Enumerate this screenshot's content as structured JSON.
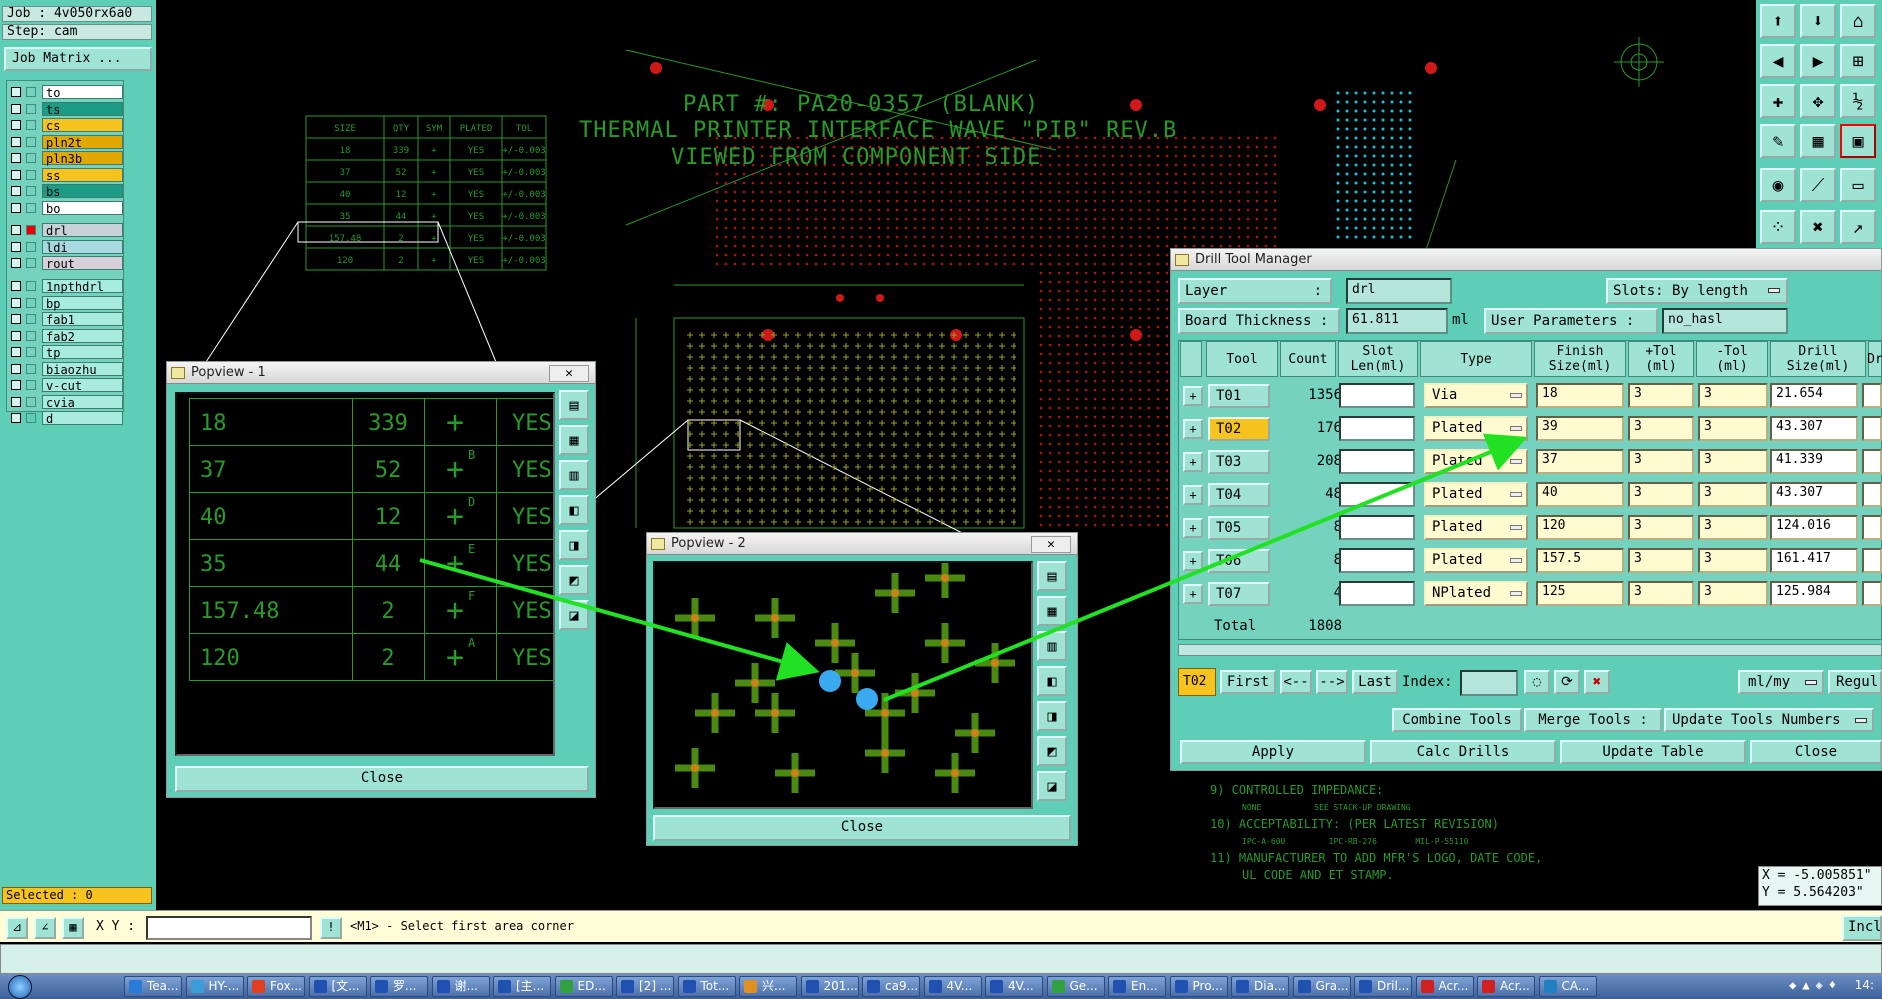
{
  "job_panel": {
    "job": "Job : 4v050rx6a0",
    "step": "Step: cam",
    "job_matrix_label": "Job Matrix ...",
    "layers": [
      {
        "name": "to",
        "color": "#ffffff",
        "pen": true
      },
      {
        "name": "ts",
        "color": "#1c9c84",
        "pen": false
      },
      {
        "name": "cs",
        "color": "#f7c31e",
        "pen": false
      },
      {
        "name": "pln2t",
        "color": "#e0a800",
        "pen": false
      },
      {
        "name": "pln3b",
        "color": "#e0a800",
        "pen": false
      },
      {
        "name": "ss",
        "color": "#f7c31e",
        "pen": false
      },
      {
        "name": "bs",
        "color": "#1c9c84",
        "pen": false
      },
      {
        "name": "bo",
        "color": "#ffffff",
        "pen": true
      },
      {
        "name": "drl",
        "color": "#c8d0d8",
        "pen": false
      },
      {
        "name": "ldi",
        "color": "#a8d8e0",
        "pen": false
      },
      {
        "name": "rout",
        "color": "#d8d0d8",
        "pen": false
      },
      {
        "name": "1npthdrl",
        "color": "#a8ece0",
        "pen": false
      },
      {
        "name": "bp",
        "color": "#a8ece0",
        "pen": false
      },
      {
        "name": "fab1",
        "color": "#a8ece0",
        "pen": true
      },
      {
        "name": "fab2",
        "color": "#a8ece0",
        "pen": true
      },
      {
        "name": "tp",
        "color": "#a8ece0",
        "pen": false
      },
      {
        "name": "biaozhu",
        "color": "#a8ece0",
        "pen": false
      },
      {
        "name": "v-cut",
        "color": "#a8ece0",
        "pen": false
      },
      {
        "name": "cvia",
        "color": "#a8ece0",
        "pen": false
      },
      {
        "name": "d",
        "color": "#a8ece0",
        "pen": false
      }
    ],
    "selected": "Selected : 0"
  },
  "canvas": {
    "title_lines": [
      "PART #: PA20-0357 (BLANK)",
      "THERMAL PRINTER INTERFACE WAVE \"PIB\" REV.B",
      "VIEWED FROM COMPONENT SIDE"
    ],
    "drill_table_headers": [
      "SIZE",
      "QTY",
      "SYM",
      "PLATED",
      "TOL"
    ],
    "drill_table_rows": [
      [
        "18",
        "339",
        "+",
        "YES",
        "+/-0.003"
      ],
      [
        "37",
        "52",
        "+",
        "YES",
        "+/-0.003"
      ],
      [
        "40",
        "12",
        "+",
        "YES",
        "+/-0.003"
      ],
      [
        "35",
        "44",
        "+",
        "YES",
        "+/-0.003"
      ],
      [
        "157.48",
        "2",
        "+",
        "YES",
        "+/-0.003"
      ],
      [
        "120",
        "2",
        "+",
        "YES",
        "+/-0.003"
      ]
    ],
    "notes": [
      "9) CONTROLLED IMPEDANCE:",
      "NONE",
      "SEE STACK-UP DRAWING",
      "10) ACCEPTABILITY: (PER LATEST REVISION)",
      "IPC-A-600",
      "IPC-RB-276",
      "MIL-P-55110",
      "11) MANUFACTURER TO ADD MFR'S LOGO, DATE CODE,",
      "UL CODE AND ET STAMP."
    ],
    "coord_x": "X = -5.005851\"",
    "coord_y": "Y = 5.564203\""
  },
  "popview1": {
    "title": "Popview - 1",
    "close_label": "Close",
    "rows": [
      {
        "size": "18",
        "qty": "339",
        "sym": "",
        "plated": "YES"
      },
      {
        "size": "37",
        "qty": "52",
        "sym": "B",
        "plated": "YES"
      },
      {
        "size": "40",
        "qty": "12",
        "sym": "D",
        "plated": "YES"
      },
      {
        "size": "35",
        "qty": "44",
        "sym": "E",
        "plated": "YES"
      },
      {
        "size": "157.48",
        "qty": "2",
        "sym": "F",
        "plated": "YES"
      },
      {
        "size": "120",
        "qty": "2",
        "sym": "A",
        "plated": "YES"
      }
    ]
  },
  "popview2": {
    "title": "Popview - 2",
    "close_label": "Close"
  },
  "drill_manager": {
    "title": "Drill Tool Manager",
    "layer_label": "Layer",
    "layer_value": "drl",
    "slots_label": "Slots:",
    "slots_value": "By length",
    "thickness_label": "Board Thickness :",
    "thickness_value": "61.811",
    "thickness_unit": "ml",
    "user_params_label": "User Parameters :",
    "user_params_value": "no_hasl",
    "columns": [
      "Tool",
      "Count",
      "Slot Len(ml)",
      "Type",
      "Finish Size(ml)",
      "+Tol (ml)",
      "-Tol (ml)",
      "Drill Size(ml)",
      "Dr"
    ],
    "tools": [
      {
        "tool": "T01",
        "count": "1356",
        "type": "Via",
        "finish": "18",
        "ptol": "3",
        "mtol": "3",
        "drill": "21.654"
      },
      {
        "tool": "T02",
        "count": "176",
        "type": "Plated",
        "finish": "39",
        "ptol": "3",
        "mtol": "3",
        "drill": "43.307"
      },
      {
        "tool": "T03",
        "count": "208",
        "type": "Plated",
        "finish": "37",
        "ptol": "3",
        "mtol": "3",
        "drill": "41.339"
      },
      {
        "tool": "T04",
        "count": "48",
        "type": "Plated",
        "finish": "40",
        "ptol": "3",
        "mtol": "3",
        "drill": "43.307"
      },
      {
        "tool": "T05",
        "count": "8",
        "type": "Plated",
        "finish": "120",
        "ptol": "3",
        "mtol": "3",
        "drill": "124.016"
      },
      {
        "tool": "T06",
        "count": "8",
        "type": "Plated",
        "finish": "157.5",
        "ptol": "3",
        "mtol": "3",
        "drill": "161.417"
      },
      {
        "tool": "T07",
        "count": "4",
        "type": "NPlated",
        "finish": "125",
        "ptol": "3",
        "mtol": "3",
        "drill": "125.984"
      }
    ],
    "total_label": "Total",
    "total_count": "1808",
    "current_tool": "T02",
    "first_label": "First",
    "prev_label": "<--",
    "next_label": "-->",
    "last_label": "Last",
    "index_label": "Index:",
    "units_value": "ml/my",
    "regul_label": "Regul",
    "combine_label": "Combine Tools",
    "merge_label": "Merge Tools :",
    "update_numbers_label": "Update Tools Numbers",
    "apply_label": "Apply",
    "calc_label": "Calc Drills",
    "update_table_label": "Update Table",
    "close_label": "Close"
  },
  "command_bar": {
    "xy_label": "X Y :",
    "prompt": "<M1> - Select first area corner",
    "incl_label": "Incl"
  },
  "taskbar": {
    "items": [
      "Tea...",
      "HY-...",
      "Fox...",
      "[文...",
      "罗...",
      "谢...",
      "[主...",
      "ED...",
      "[2] ...",
      "Tot...",
      "兴...",
      "201...",
      "ca9...",
      "4V...",
      "4V...",
      "Ge...",
      "En...",
      "Pro...",
      "Dia...",
      "Gra...",
      "Dril...",
      "Acr...",
      "Acr...",
      "CA..."
    ],
    "clock": "14:"
  }
}
